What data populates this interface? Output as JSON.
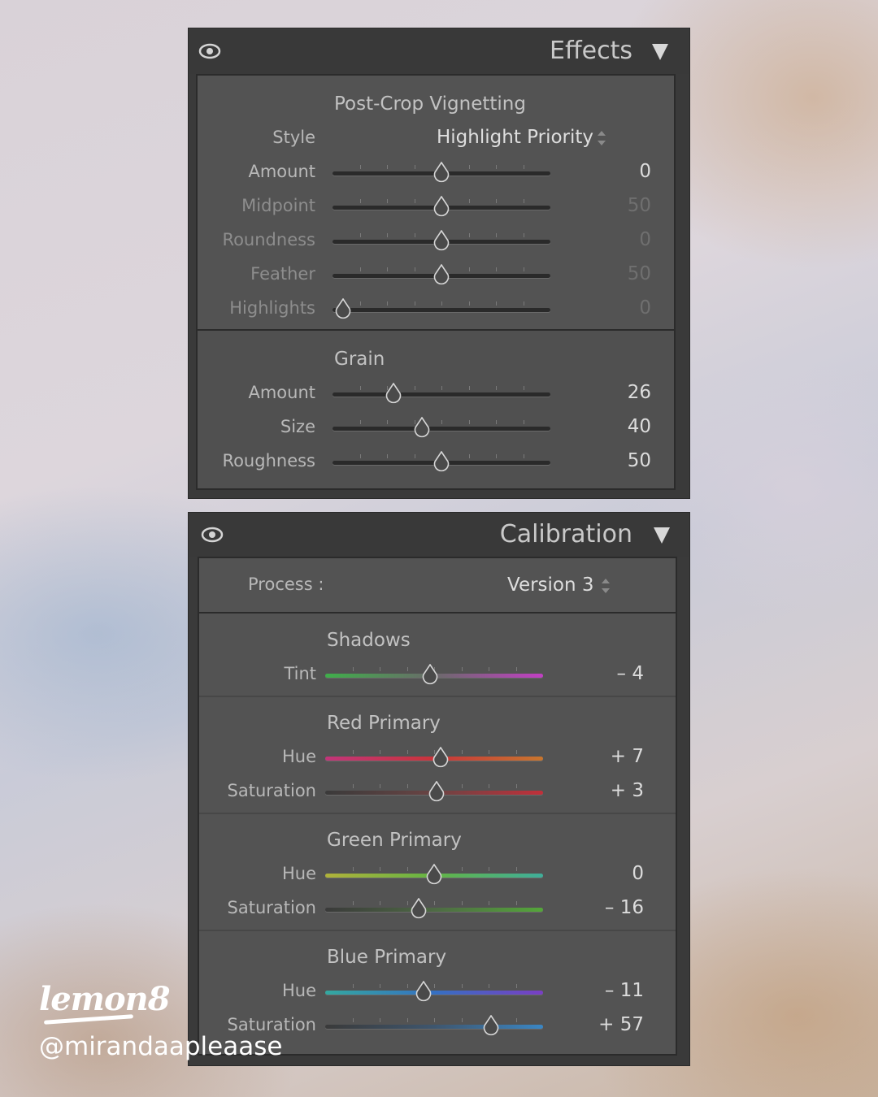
{
  "effects": {
    "title": "Effects",
    "vignette": {
      "heading": "Post-Crop Vignetting",
      "style_label": "Style",
      "style_value": "Highlight Priority",
      "sliders": [
        {
          "label": "Amount",
          "value": "0",
          "pos": 0.5,
          "dim": false
        },
        {
          "label": "Midpoint",
          "value": "50",
          "pos": 0.5,
          "dim": true
        },
        {
          "label": "Roundness",
          "value": "0",
          "pos": 0.5,
          "dim": true
        },
        {
          "label": "Feather",
          "value": "50",
          "pos": 0.5,
          "dim": true
        },
        {
          "label": "Highlights",
          "value": "0",
          "pos": 0.05,
          "dim": true
        }
      ]
    },
    "grain": {
      "heading": "Grain",
      "sliders": [
        {
          "label": "Amount",
          "value": "26",
          "pos": 0.28
        },
        {
          "label": "Size",
          "value": "40",
          "pos": 0.41
        },
        {
          "label": "Roughness",
          "value": "50",
          "pos": 0.5
        }
      ]
    }
  },
  "calibration": {
    "title": "Calibration",
    "process_label": "Process :",
    "process_value": "Version 3",
    "groups": [
      {
        "heading": "Shadows",
        "sliders": [
          {
            "label": "Tint",
            "value": "– 4",
            "pos": 0.48,
            "gradient": [
              "#3fae4a",
              "#6a6a6a",
              "#c23fc4"
            ]
          }
        ]
      },
      {
        "heading": "Red Primary",
        "sliders": [
          {
            "label": "Hue",
            "value": "+ 7",
            "pos": 0.53,
            "gradient": [
              "#c2357a",
              "#c9343a",
              "#c8762e"
            ]
          },
          {
            "label": "Saturation",
            "value": "+ 3",
            "pos": 0.51,
            "gradient": [
              "#3a3a3a",
              "#6a4444",
              "#c0303a"
            ]
          }
        ]
      },
      {
        "heading": "Green Primary",
        "sliders": [
          {
            "label": "Hue",
            "value": "0",
            "pos": 0.5,
            "gradient": [
              "#b0b23a",
              "#63b444",
              "#3fae9a"
            ]
          },
          {
            "label": "Saturation",
            "value": "– 16",
            "pos": 0.43,
            "gradient": [
              "#3a3a3a",
              "#4e6a44",
              "#54a63a"
            ]
          }
        ]
      },
      {
        "heading": "Blue Primary",
        "sliders": [
          {
            "label": "Hue",
            "value": "– 11",
            "pos": 0.45,
            "gradient": [
              "#34a8a0",
              "#3570c2",
              "#7a3ec4"
            ]
          },
          {
            "label": "Saturation",
            "value": "+ 57",
            "pos": 0.76,
            "gradient": [
              "#3a3a3a",
              "#3e566e",
              "#3a86c4"
            ]
          }
        ]
      }
    ]
  },
  "watermark": {
    "logo": "lemon8",
    "handle": "@mirandaapleaase"
  },
  "colors": {
    "panel_bg": "#3a3a3a",
    "box_bg": "#535353",
    "text": "#c2c2c2"
  }
}
